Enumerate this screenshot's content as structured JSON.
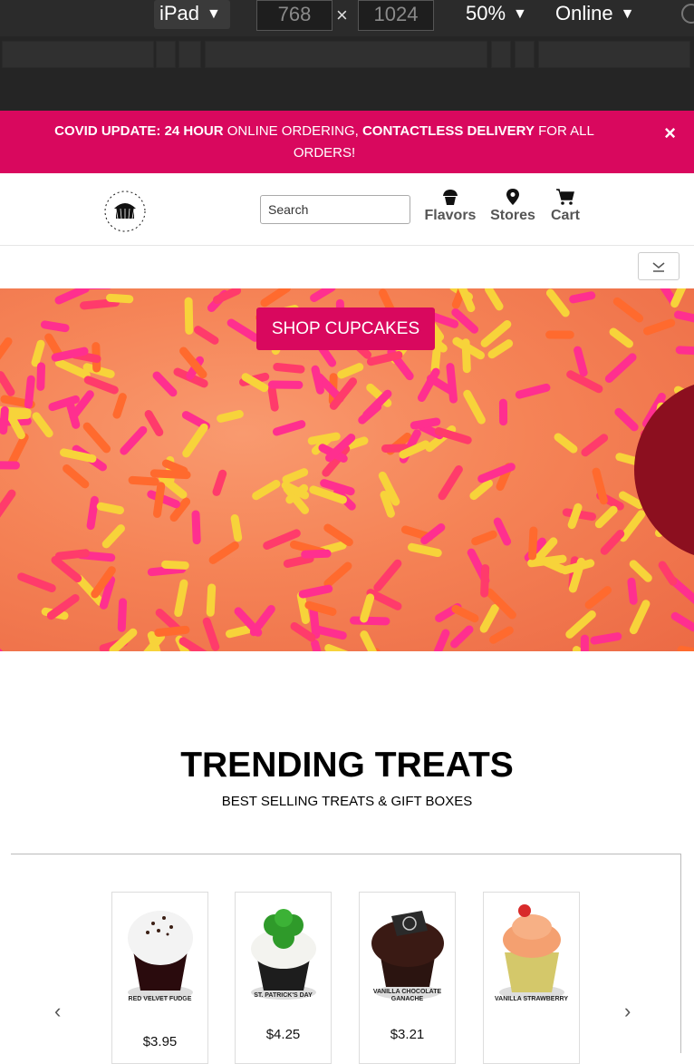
{
  "devtools": {
    "device": "iPad",
    "width": "768",
    "height": "1024",
    "times": "×",
    "zoom": "50%",
    "network": "Online",
    "caret": "▼"
  },
  "banner": {
    "lead": "COVID UPDATE: 24 HOUR",
    "mid1": " ONLINE ORDERING, ",
    "bold2": "CONTACTLESS DELIVERY",
    "tail": " FOR ALL ORDERS!",
    "close": "×"
  },
  "header": {
    "logo_text": "TORONTO CUPCAKE",
    "search_placeholder": "Search",
    "nav": [
      {
        "label": "Flavors",
        "icon": "cupcake-icon"
      },
      {
        "label": "Stores",
        "icon": "map-pin-icon"
      },
      {
        "label": "Cart",
        "icon": "cart-icon"
      }
    ]
  },
  "hero": {
    "button": "SHOP CUPCAKES"
  },
  "trending": {
    "title": "TRENDING TREATS",
    "subtitle": "BEST SELLING TREATS & GIFT BOXES",
    "prev": "‹",
    "next": "›",
    "products": [
      {
        "label": "RED VELVET FUDGE",
        "price": "$3.95"
      },
      {
        "label": "ST. PATRICK'S DAY",
        "price": "$4.25"
      },
      {
        "label": "VANILLA CHOCOLATE GANACHE",
        "price": "$3.21"
      },
      {
        "label": "VANILLA STRAWBERRY",
        "price": ""
      }
    ]
  },
  "colors": {
    "brand_pink": "#d9085e"
  }
}
